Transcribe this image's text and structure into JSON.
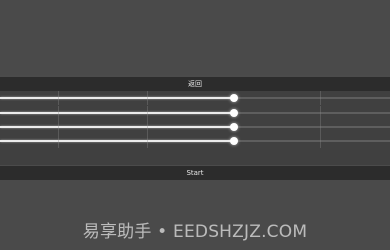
{
  "buttons": {
    "back_label": "返回",
    "start_label": "Start"
  },
  "sliders": [
    {
      "name": "slider-1",
      "value": 0.6
    },
    {
      "name": "slider-2",
      "value": 0.6
    },
    {
      "name": "slider-3",
      "value": 0.6
    },
    {
      "name": "slider-4",
      "value": 0.6
    }
  ],
  "watermark": {
    "text": "易享助手 • EEDSHZJZ.COM"
  },
  "colors": {
    "background": "#4b4b4b",
    "bar": "#2c2c2c",
    "panel": "#404040",
    "slider_fill": "#ececec",
    "slider_track": "#5e5e5e"
  }
}
